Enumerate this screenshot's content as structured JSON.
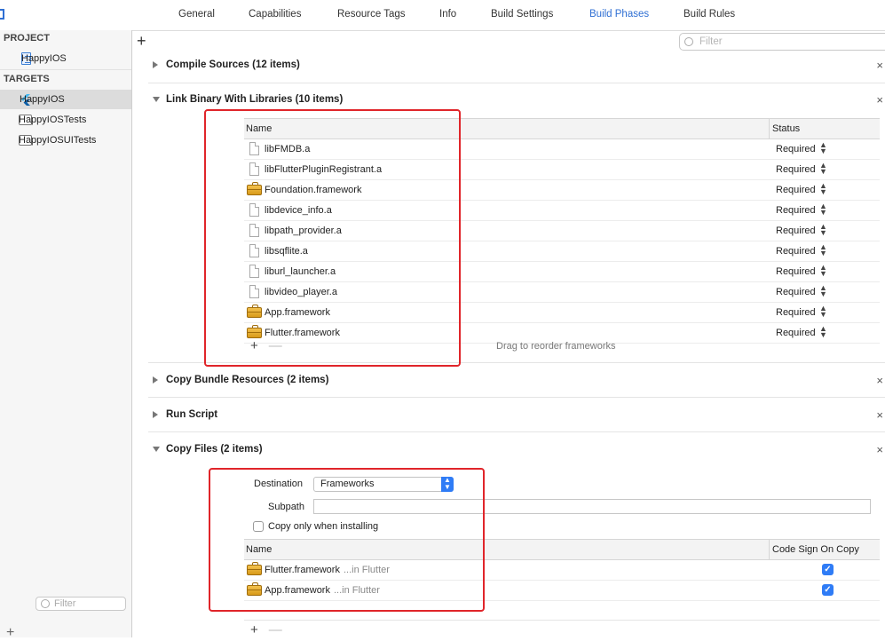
{
  "tabs": [
    {
      "label": "General",
      "active": false
    },
    {
      "label": "Capabilities",
      "active": false
    },
    {
      "label": "Resource Tags",
      "active": false
    },
    {
      "label": "Info",
      "active": false
    },
    {
      "label": "Build Settings",
      "active": false
    },
    {
      "label": "Build Phases",
      "active": true
    },
    {
      "label": "Build Rules",
      "active": false
    }
  ],
  "sidebar": {
    "project_header": "PROJECT",
    "project_item": "HappyIOS",
    "targets_header": "TARGETS",
    "targets": [
      {
        "label": "HappyIOS",
        "selected": true,
        "icon": "flutter-icon"
      },
      {
        "label": "HappyIOSTests",
        "selected": false,
        "icon": "folder-icon"
      },
      {
        "label": "HappyIOSUITests",
        "selected": false,
        "icon": "folder-icon"
      }
    ],
    "filter_placeholder": "Filter"
  },
  "toolbar": {
    "add_label": "+",
    "filter_placeholder": "Filter"
  },
  "phases": {
    "compile_sources": {
      "title": "Compile Sources (12 items)",
      "expanded": false
    },
    "link_binary": {
      "title": "Link Binary With Libraries (10 items)",
      "expanded": true,
      "columns": [
        "Name",
        "Status"
      ],
      "rows": [
        {
          "name": "libFMDB.a",
          "status": "Required",
          "icon": "file-icon"
        },
        {
          "name": "libFlutterPluginRegistrant.a",
          "status": "Required",
          "icon": "file-icon"
        },
        {
          "name": "Foundation.framework",
          "status": "Required",
          "icon": "toolbox-icon"
        },
        {
          "name": "libdevice_info.a",
          "status": "Required",
          "icon": "file-icon"
        },
        {
          "name": "libpath_provider.a",
          "status": "Required",
          "icon": "file-icon"
        },
        {
          "name": "libsqflite.a",
          "status": "Required",
          "icon": "file-icon"
        },
        {
          "name": "liburl_launcher.a",
          "status": "Required",
          "icon": "file-icon"
        },
        {
          "name": "libvideo_player.a",
          "status": "Required",
          "icon": "file-icon"
        },
        {
          "name": "App.framework",
          "status": "Required",
          "icon": "toolbox-icon"
        },
        {
          "name": "Flutter.framework",
          "status": "Required",
          "icon": "toolbox-icon"
        }
      ],
      "add_label": "+",
      "remove_label": "—",
      "drag_hint": "Drag to reorder frameworks"
    },
    "copy_bundle": {
      "title": "Copy Bundle Resources (2 items)",
      "expanded": false
    },
    "run_script": {
      "title": "Run Script",
      "expanded": false
    },
    "copy_files": {
      "title": "Copy Files (2 items)",
      "expanded": true,
      "destination_label": "Destination",
      "destination_value": "Frameworks",
      "subpath_label": "Subpath",
      "subpath_value": "",
      "copy_only_label": "Copy only when installing",
      "copy_only_checked": false,
      "columns": [
        "Name",
        "Code Sign On Copy"
      ],
      "rows": [
        {
          "name": "Flutter.framework",
          "location": "...in Flutter",
          "code_sign": true
        },
        {
          "name": "App.framework",
          "location": "...in Flutter",
          "code_sign": true
        }
      ],
      "add_label": "+",
      "remove_label": "—"
    }
  },
  "close_glyph": "×",
  "highlight_color": "#e0252a",
  "accent_color": "#2f7cf6"
}
